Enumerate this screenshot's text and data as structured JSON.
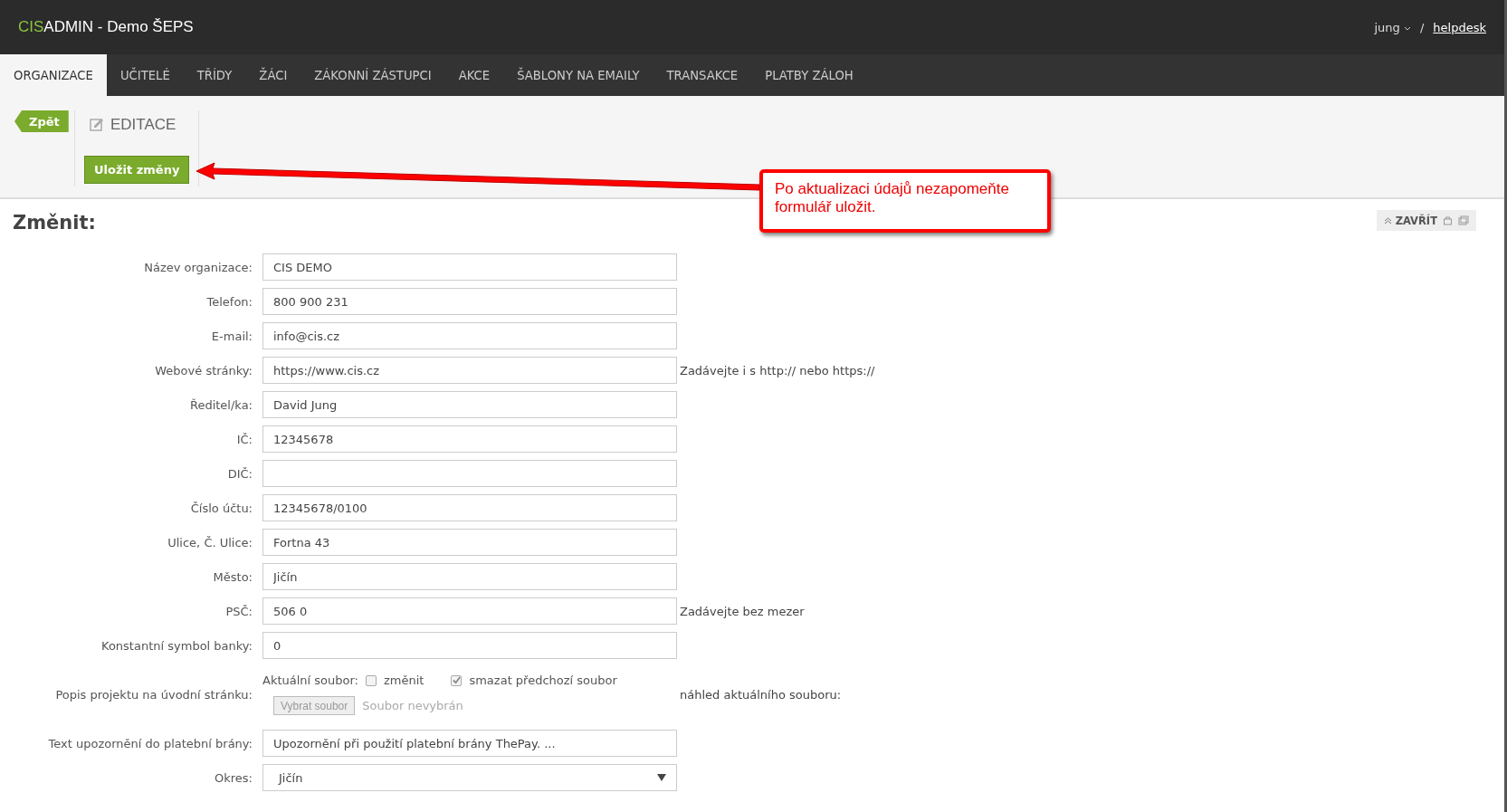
{
  "header": {
    "brand_accent": "CIS",
    "brand_rest": "ADMIN",
    "title": "- Demo ŠEPS",
    "user": "jung",
    "separator": "/",
    "helpdesk": "helpdesk"
  },
  "nav": [
    {
      "label": "ORGANIZACE",
      "selected": true
    },
    {
      "label": "UČITELÉ",
      "selected": false
    },
    {
      "label": "TŘÍDY",
      "selected": false
    },
    {
      "label": "ŽÁCI",
      "selected": false
    },
    {
      "label": "ZÁKONNÍ ZÁSTUPCI",
      "selected": false
    },
    {
      "label": "AKCE",
      "selected": false
    },
    {
      "label": "ŠABLONY NA EMAILY",
      "selected": false
    },
    {
      "label": "TRANSAKCE",
      "selected": false
    },
    {
      "label": "PLATBY ZÁLOH",
      "selected": false
    }
  ],
  "toolbar": {
    "back": "Zpět",
    "section": "EDITACE",
    "save": "Uložit změny"
  },
  "callout": "Po aktualizaci údajů nezapomeňte formulář uložit.",
  "panel": {
    "heading": "Změnit:",
    "close": "ZAVŘÍT"
  },
  "fields": [
    {
      "kind": "text",
      "label": "Název organizace:",
      "value": "CIS DEMO"
    },
    {
      "kind": "text",
      "label": "Telefon:",
      "value": "800 900 231"
    },
    {
      "kind": "text",
      "label": "E-mail:",
      "value": "info@cis.cz"
    },
    {
      "kind": "text",
      "label": "Webové stránky:",
      "value": "https://www.cis.cz",
      "hint": "Zadávejte i s http:// nebo https://"
    },
    {
      "kind": "text",
      "label": "Ředitel/ka:",
      "value": "David Jung"
    },
    {
      "kind": "text",
      "label": "IČ:",
      "value": "12345678"
    },
    {
      "kind": "text",
      "label": "DIČ:"
    },
    {
      "kind": "text",
      "label": "Číslo účtu:",
      "value": "12345678/0100"
    },
    {
      "kind": "text",
      "label": "Ulice, Č. Ulice:",
      "value": "Fortna 43"
    },
    {
      "kind": "text",
      "label": "Město:",
      "value": "Jičín"
    },
    {
      "kind": "text",
      "label": "PSČ:",
      "value": "506 0",
      "hint": "Zadávejte bez mezer"
    },
    {
      "kind": "text",
      "label": "Konstantní symbol banky:",
      "value": "0"
    },
    {
      "kind": "file",
      "label": "Popis projektu na úvodní stránku:",
      "current": "Aktuální soubor:",
      "options": [
        {
          "label": "změnit",
          "checked": false
        },
        {
          "label": "smazat předchozí soubor",
          "checked": true
        }
      ],
      "button": "Vybrat soubor",
      "status": "Soubor nevybrán",
      "hint": "náhled aktuálního souboru:"
    },
    {
      "kind": "text",
      "label": "Text upozornění do platební brány:",
      "value": "Upozornění při použití platební brány ThePay. ..."
    },
    {
      "kind": "select",
      "label": "Okres:",
      "value": "Jičín"
    }
  ]
}
